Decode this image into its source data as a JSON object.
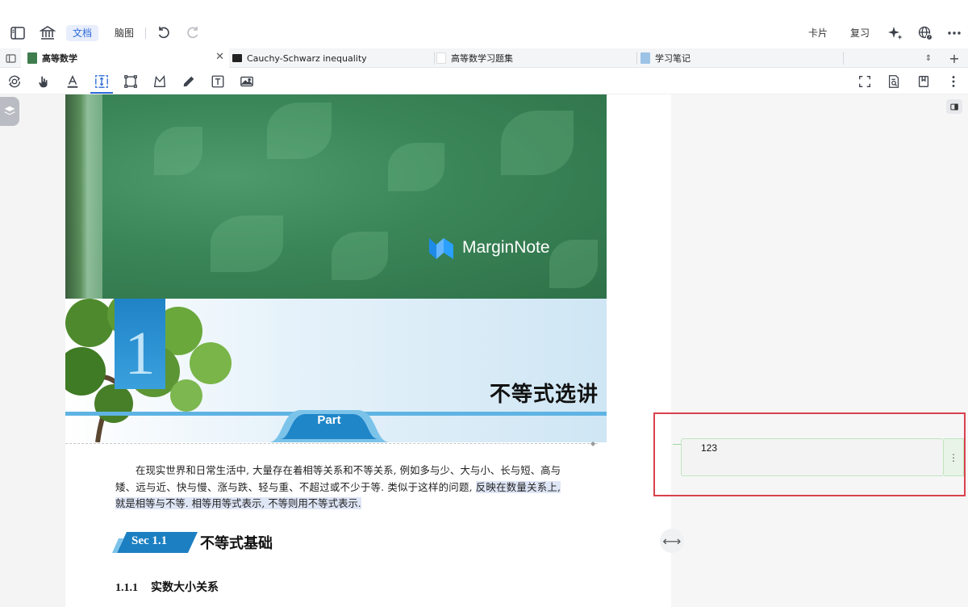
{
  "toolbar": {
    "modes": [
      {
        "label": "文档",
        "active": true
      },
      {
        "label": "脑图",
        "active": false
      }
    ],
    "right_buttons": [
      {
        "label": "卡片"
      },
      {
        "label": "复习"
      }
    ]
  },
  "tabs": [
    {
      "label": "高等数学",
      "icon": "book-green-icon",
      "active": true,
      "closable": true
    },
    {
      "label": "Cauchy-Schwarz inequality",
      "icon": "terminal-icon",
      "active": false
    },
    {
      "label": "高等数学习题集",
      "icon": "document-icon",
      "active": false
    },
    {
      "label": "学习笔记",
      "icon": "notebook-blue-icon",
      "active": false
    }
  ],
  "tools": [
    "gesture-icon",
    "hand-icon",
    "text-highlight-icon",
    "select-icon",
    "rectangle-icon",
    "lasso-icon",
    "pen-icon",
    "textbox-icon",
    "image-icon"
  ],
  "document": {
    "brand": "MarginNote",
    "chapter_number": "1",
    "chapter_title": "不等式选讲",
    "part_label": "Part",
    "paragraph_plain": "在现实世界和日常生活中, 大量存在着相等关系和不等关系, 例如多与少、大与小、长与短、高与矮、远与近、快与慢、涨与跌、轻与重、不超过或不少于等. 类似于这样的问题, ",
    "paragraph_highlight": "反映在数量关系上, 就是相等与不等. 相等用等式表示, 不等则用不等式表示.",
    "section_badge": "Sec 1.1",
    "section_title": "不等式基础",
    "subsection_number": "1.1.1",
    "subsection_title": "实数大小关系"
  },
  "mindmap": {
    "note_text": "123"
  },
  "colors": {
    "accent": "#2f6bd8",
    "highlight": "#dfe6f6",
    "card_border": "#bfe6bf",
    "annotation_frame": "#d9414d"
  }
}
